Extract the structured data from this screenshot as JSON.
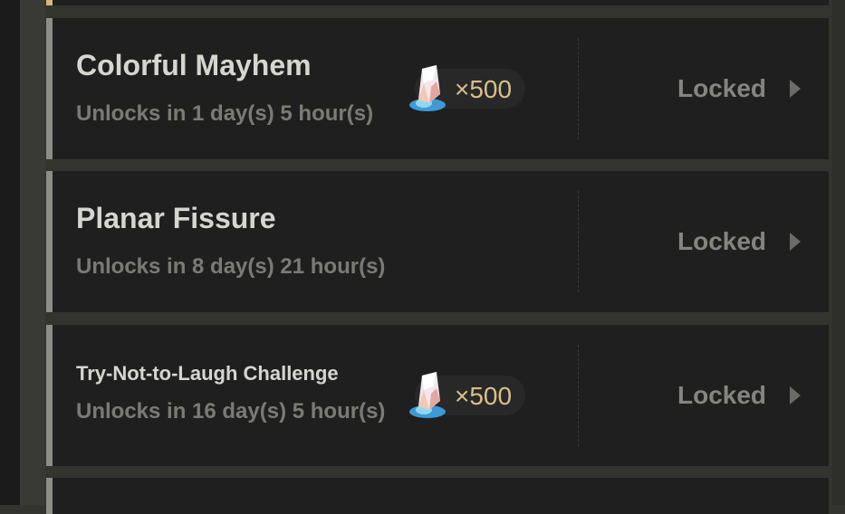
{
  "events": [
    {
      "title": "Colorful Mayhem",
      "subtitle": "Unlocks in 1 day(s) 5 hour(s)",
      "reward": {
        "icon": "crystal-icon",
        "count": "×500"
      },
      "status": "Locked"
    },
    {
      "title": "Planar Fissure",
      "subtitle": "Unlocks in 8 day(s) 21 hour(s)",
      "status": "Locked"
    },
    {
      "title": "Try-Not-to-Laugh Challenge",
      "subtitle": "Unlocks in 16 day(s) 5 hour(s)",
      "reward": {
        "icon": "crystal-icon",
        "count": "×500"
      },
      "status": "Locked"
    }
  ],
  "colors": {
    "card_bg": "#1f1f1f",
    "accent_gold": "#d8c08c",
    "text_primary": "#d6d6d1",
    "text_muted": "#7b7b76"
  }
}
